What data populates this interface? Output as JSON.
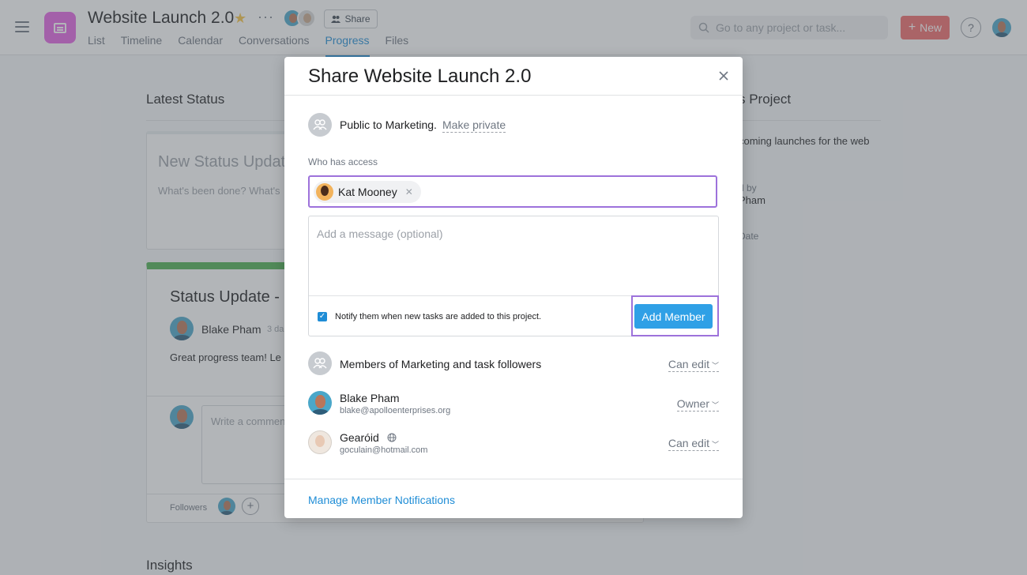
{
  "project": {
    "title": "Website Launch 2.0",
    "share_label": "Share"
  },
  "tabs": [
    "List",
    "Timeline",
    "Calendar",
    "Conversations",
    "Progress",
    "Files"
  ],
  "active_tab": "Progress",
  "search": {
    "placeholder": "Go to any project or task..."
  },
  "new_label": "New",
  "help_label": "?",
  "background": {
    "latest_status": "Latest Status",
    "new_status_update": "New Status Update",
    "whats_been_done": "What's been done? What's",
    "status_update_title": "Status Update -",
    "author": "Blake Pham",
    "posted": "3 da",
    "message": "Great progress team! Le",
    "write_comment": "Write a commen",
    "followers_label": "Followers",
    "insights": "Insights",
    "about_project": "s Project",
    "about_desc": "coming launches for the web",
    "created_by_label": "d by",
    "created_by_name": "Pham",
    "date_label": "Date"
  },
  "modal": {
    "title": "Share Website Launch 2.0",
    "public_text": "Public to Marketing.",
    "make_private": "Make private",
    "access_label": "Who has access",
    "token_name": "Kat Mooney",
    "message_placeholder": "Add a message (optional)",
    "notify_text": "Notify them when new tasks are added to this project.",
    "notify_checked": true,
    "add_member": "Add Member",
    "members": [
      {
        "name": "Members of Marketing and task followers",
        "email": "",
        "permission": "Can edit"
      },
      {
        "name": "Blake Pham",
        "email": "blake@apolloenterprises.org",
        "permission": "Owner"
      },
      {
        "name": "Gearóid",
        "email": "goculain@hotmail.com",
        "permission": "Can edit"
      }
    ],
    "manage_link": "Manage Member Notifications"
  },
  "colors": {
    "accent": "#1f8dd6",
    "new_button": "#f06a6a",
    "project_icon": "#e362e3",
    "highlight_frame": "#9d72db",
    "status_green": "#4caf50"
  }
}
